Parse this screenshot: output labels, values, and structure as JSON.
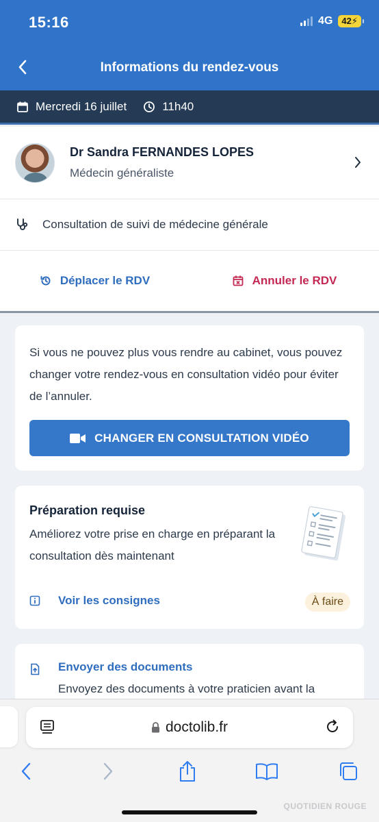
{
  "status": {
    "time": "15:16",
    "network": "4G",
    "battery": "42"
  },
  "nav": {
    "title": "Informations du rendez-vous"
  },
  "appointment": {
    "date": "Mercredi 16 juillet",
    "time": "11h40"
  },
  "doctor": {
    "name": "Dr Sandra FERNANDES LOPES",
    "specialty": "Médecin généraliste"
  },
  "consultation": {
    "reason": "Consultation de suivi de médecine générale"
  },
  "actions": {
    "move_label": "Déplacer le RDV",
    "cancel_label": "Annuler le RDV"
  },
  "video_card": {
    "text": "Si vous ne pouvez plus vous rendre au cabinet, vous pouvez changer votre rendez-vous en consultation vidéo pour éviter de l’annuler.",
    "button_label": "CHANGER EN CONSULTATION VIDÉO"
  },
  "prep_card": {
    "title": "Préparation requise",
    "text": "Améliorez votre prise en charge en préparant la consultation dès maintenant",
    "link_label": "Voir les consignes",
    "status_badge": "À faire"
  },
  "docs_card": {
    "title": "Envoyer des documents",
    "text": "Envoyez des documents à votre praticien avant la"
  },
  "browser": {
    "url": "doctolib.fr"
  },
  "watermark": "QUOTIDIEN ROUGE",
  "colors": {
    "primary": "#2f74c8",
    "datebar": "#253a55",
    "cancel": "#c42852",
    "link": "#2f6dbf"
  }
}
